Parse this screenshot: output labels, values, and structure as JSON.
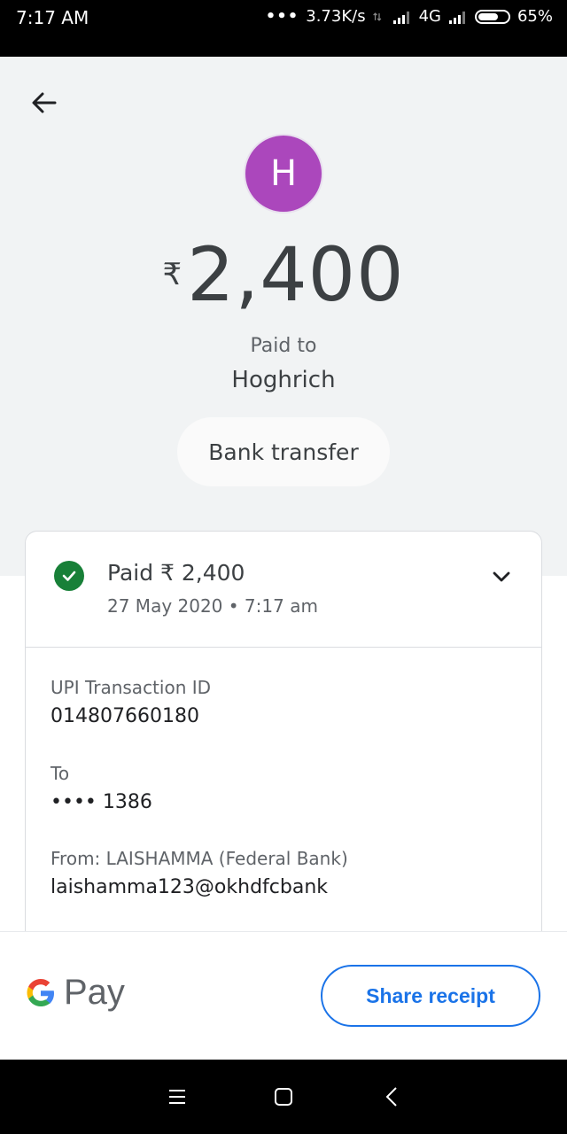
{
  "status_bar": {
    "time": "7:17 AM",
    "speed": "3.73K/s",
    "network": "4G",
    "battery": "65%"
  },
  "payment": {
    "avatar_initial": "H",
    "currency": "₹",
    "amount": "2,400",
    "paid_to_label": "Paid to",
    "payee": "Hoghrich",
    "method_chip": "Bank transfer"
  },
  "details": {
    "summary": "Paid ₹ 2,400",
    "date": "27 May 2020 • 7:17 am",
    "upi_label": "UPI Transaction ID",
    "upi_value": "014807660180",
    "to_label": "To",
    "to_value": "•••• 1386",
    "from_label": "From: LAISHAMMA (Federal Bank)",
    "from_value": "laishamma123@okhdfcbank"
  },
  "footer": {
    "brand": "Pay",
    "share_label": "Share receipt"
  },
  "colors": {
    "accent": "#1a73e8",
    "success": "#188038",
    "avatar": "#ab47bc"
  },
  "icons": [
    "back-arrow-icon",
    "check-icon",
    "chevron-down-icon",
    "google-g-icon",
    "menu-icon",
    "home-icon",
    "back-icon"
  ]
}
